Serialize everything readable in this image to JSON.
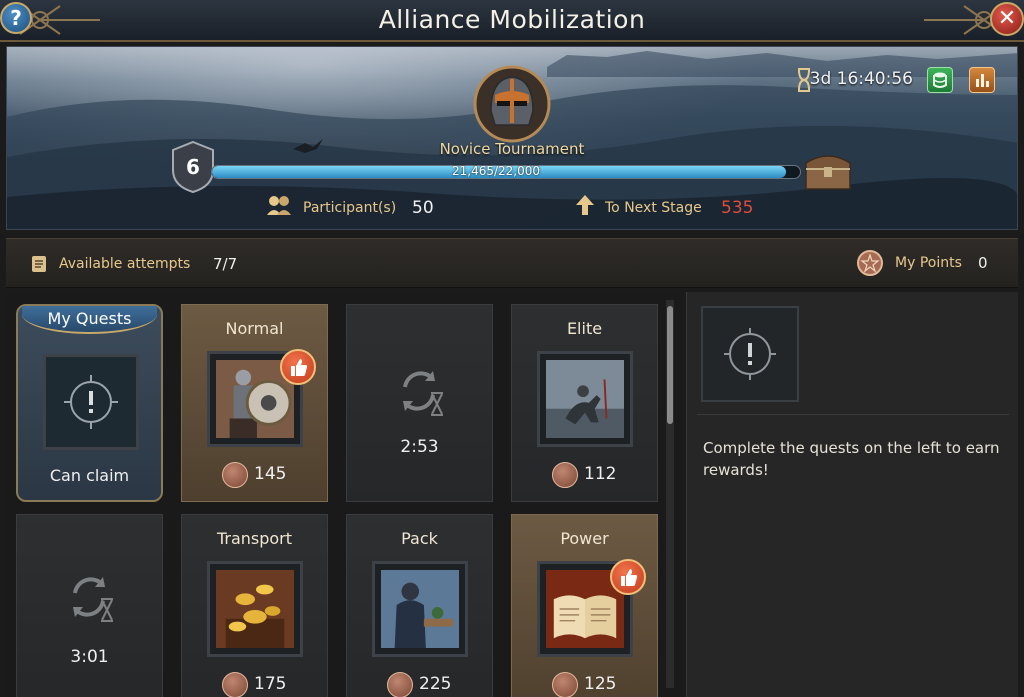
{
  "window": {
    "title": "Alliance Mobilization"
  },
  "banner": {
    "stage_name": "Novice Tournament",
    "level": "6",
    "progress_text": "21,465/22,000",
    "progress_fraction": 0.9757,
    "timer": "3d 16:40:56",
    "participant_label": "Participant(s)",
    "participant_value": "50",
    "next_stage_label": "To Next Stage",
    "next_stage_value": "535"
  },
  "infobar": {
    "attempts_label": "Available attempts",
    "attempts_value": "7/7",
    "points_label": "My Points",
    "points_value": "0"
  },
  "quests": [
    {
      "kind": "my-quests",
      "tab_label": "My Quests",
      "status": "Can claim"
    },
    {
      "kind": "quest",
      "title": "Normal",
      "points": "145",
      "recommended": true,
      "image": "knight-shield"
    },
    {
      "kind": "cooldown",
      "time": "2:53"
    },
    {
      "kind": "quest",
      "title": "Elite",
      "points": "112",
      "recommended": false,
      "image": "cavalry-battle"
    },
    {
      "kind": "cooldown",
      "time": "3:01"
    },
    {
      "kind": "quest",
      "title": "Transport",
      "points": "175",
      "recommended": false,
      "image": "gold-coins"
    },
    {
      "kind": "quest",
      "title": "Pack",
      "points": "225",
      "recommended": false,
      "image": "merchant"
    },
    {
      "kind": "quest",
      "title": "Power",
      "points": "125",
      "recommended": true,
      "image": "open-book"
    }
  ],
  "rewards": {
    "hint": "Complete the quests on the left to earn rewards!"
  },
  "colors": {
    "accent_gold": "#e7c88c",
    "warning_red": "#e14b3c",
    "progress_blue": "#2b8bc4"
  }
}
